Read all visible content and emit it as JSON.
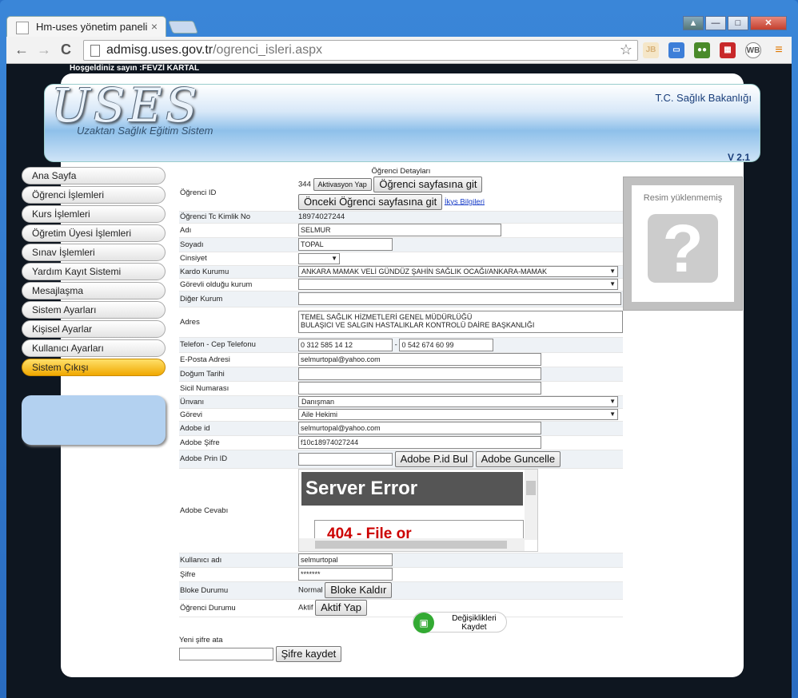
{
  "browser": {
    "tab_title": "Hm-uses yönetim paneli",
    "tab_close": "×",
    "url_host": "admisg.uses.gov.tr",
    "url_path": "/ogrenci_isleri.aspx",
    "nav_back": "←",
    "nav_forward": "→",
    "nav_reload": "C",
    "star": "☆"
  },
  "page": {
    "welcome": "Hoşgeldiniz sayın :FEVZİ KARTAL",
    "logo": "USES",
    "logo_sub": "Uzaktan Sağlık Eğitim Sistem",
    "ministry": "T.C.  Sağlık Bakanlığı",
    "version": "V  2.1"
  },
  "menu": [
    "Ana Sayfa",
    "Öğrenci İşlemleri",
    "Kurs İşlemleri",
    "Öğretim Üyesi İşlemleri",
    "Sınav İşlemleri",
    "Yardım Kayıt Sistemi",
    "Mesajlaşma",
    "Sistem Ayarları",
    "Kişisel Ayarlar",
    "Kullanıcı Ayarları",
    "Sistem Çıkışı"
  ],
  "form": {
    "heading": "Öğrenci Detayları",
    "photo_text": "Resim yüklenmemiş",
    "photo_glyph": "?",
    "ogrenci_id": {
      "label": "Öğrenci ID",
      "value": "344",
      "btn_activate": "Aktivasyon Yap",
      "btn_goto": "Öğrenci sayfasına git",
      "btn_prev": "Önceki Öğrenci sayfasına git",
      "link": "İkys Bilgileri"
    },
    "tc": {
      "label": "Öğrenci Tc Kimlik No",
      "value": "18974027244"
    },
    "adi": {
      "label": "Adı",
      "value": "SELMUR"
    },
    "soyadi": {
      "label": "Soyadı",
      "value": "TOPAL"
    },
    "cinsiyet": {
      "label": "Cinsiyet",
      "value": ""
    },
    "kardo": {
      "label": "Kardo Kurumu",
      "value": "ANKARA MAMAK VELİ GÜNDÜZ ŞAHİN SAĞLIK OCAĞI/ANKARA-MAMAK"
    },
    "gorevli": {
      "label": "Görevli olduğu kurum",
      "value": ""
    },
    "diger": {
      "label": "Diğer Kurum",
      "value": ""
    },
    "adres": {
      "label": "Adres",
      "line1": "TEMEL SAĞLIK HİZMETLERİ GENEL MÜDÜRLÜĞÜ",
      "line2": "BULAŞICI VE SALGIN HASTALIKLAR KONTROLÜ DAİRE BAŞKANLIĞI"
    },
    "telefon": {
      "label": "Telefon - Cep Telefonu",
      "tel": "0 312 585 14 12",
      "sep": "-",
      "cep": "0 542 674 60 99"
    },
    "email": {
      "label": "E-Posta Adresi",
      "value": "selmurtopal@yahoo.com"
    },
    "dogum": {
      "label": "Doğum Tarihi",
      "value": ""
    },
    "sicil": {
      "label": "Sicil Numarası",
      "value": ""
    },
    "unvan": {
      "label": "Ünvanı",
      "value": "Danışman"
    },
    "gorevi": {
      "label": "Görevi",
      "value": "Aile Hekimi"
    },
    "adobe_id": {
      "label": "Adobe id",
      "value": "selmurtopal@yahoo.com"
    },
    "adobe_sifre": {
      "label": "Adobe Şifre",
      "value": "f10c18974027244"
    },
    "adobe_prin": {
      "label": "Adobe Prin ID",
      "value": "",
      "btn_find": "Adobe P.id Bul",
      "btn_update": "Adobe Guncelle"
    },
    "adobe_cevap": {
      "label": "Adobe Cevabı",
      "error_title": "Server Error",
      "error_msg": "404 - File or"
    },
    "kullanici": {
      "label": "Kullanıcı adı",
      "value": "selmurtopal"
    },
    "sifre": {
      "label": "Şifre",
      "value": "*******"
    },
    "bloke": {
      "label": "Bloke Durumu",
      "value": "Normal",
      "btn": "Bloke Kaldır"
    },
    "durum": {
      "label": "Öğrenci Durumu",
      "value": "Aktif",
      "btn": "Aktif Yap"
    },
    "save": {
      "line1": "Değişiklikleri",
      "line2": "Kaydet"
    },
    "new_pw": {
      "label": "Yeni şifre ata",
      "value": "",
      "btn": "Şifre kaydet"
    }
  }
}
